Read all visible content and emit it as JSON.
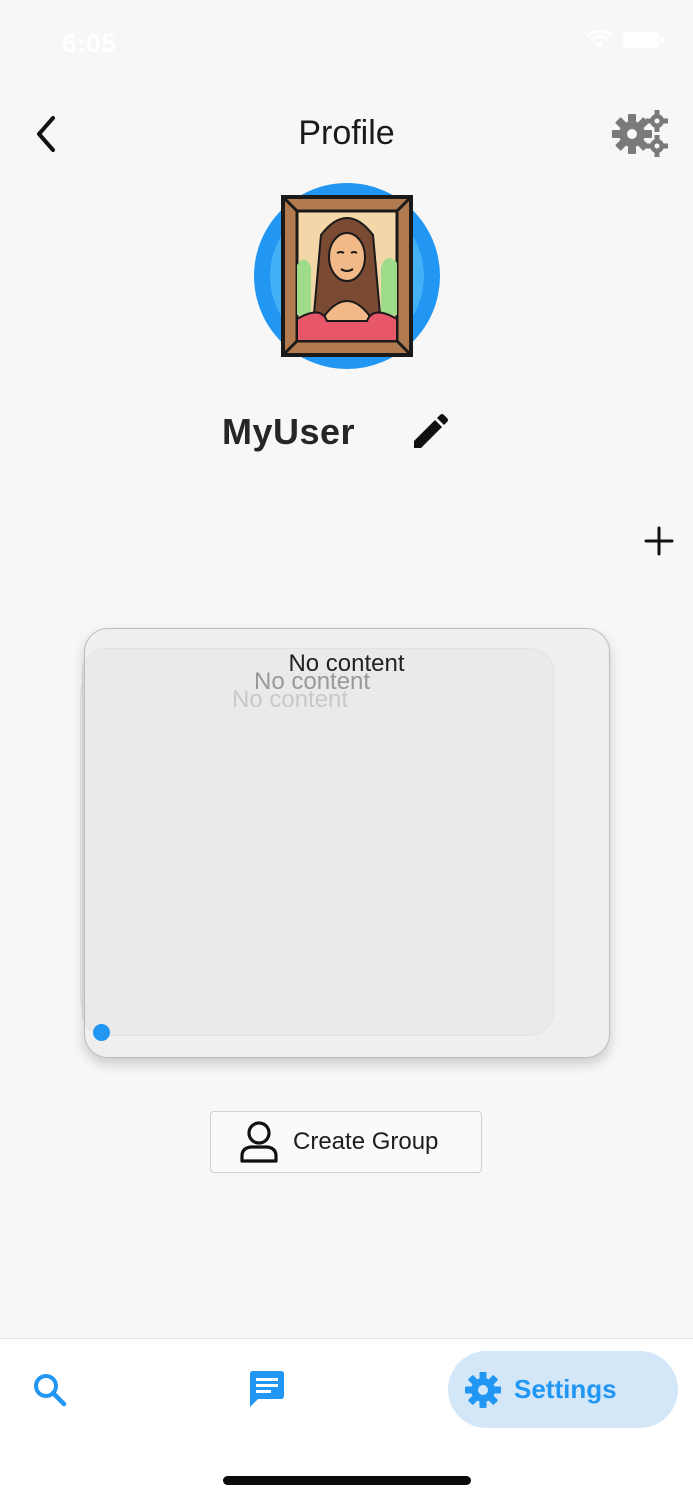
{
  "status_bar": {
    "time": "6:05"
  },
  "header": {
    "title": "Profile"
  },
  "profile": {
    "username": "MyUser"
  },
  "cards": {
    "front_text": "No content",
    "middle_text": "No content",
    "back_text": "No content"
  },
  "actions": {
    "create_group_label": "Create Group"
  },
  "bottom_nav": {
    "items": [
      {
        "icon": "search-icon",
        "label": ""
      },
      {
        "icon": "chat-icon",
        "label": ""
      },
      {
        "icon": "gear-icon",
        "label": "Settings",
        "active": true
      }
    ]
  },
  "colors": {
    "accent": "#2196f3",
    "active_nav_bg": "#d3e7f9",
    "background": "#f7f7f7"
  }
}
